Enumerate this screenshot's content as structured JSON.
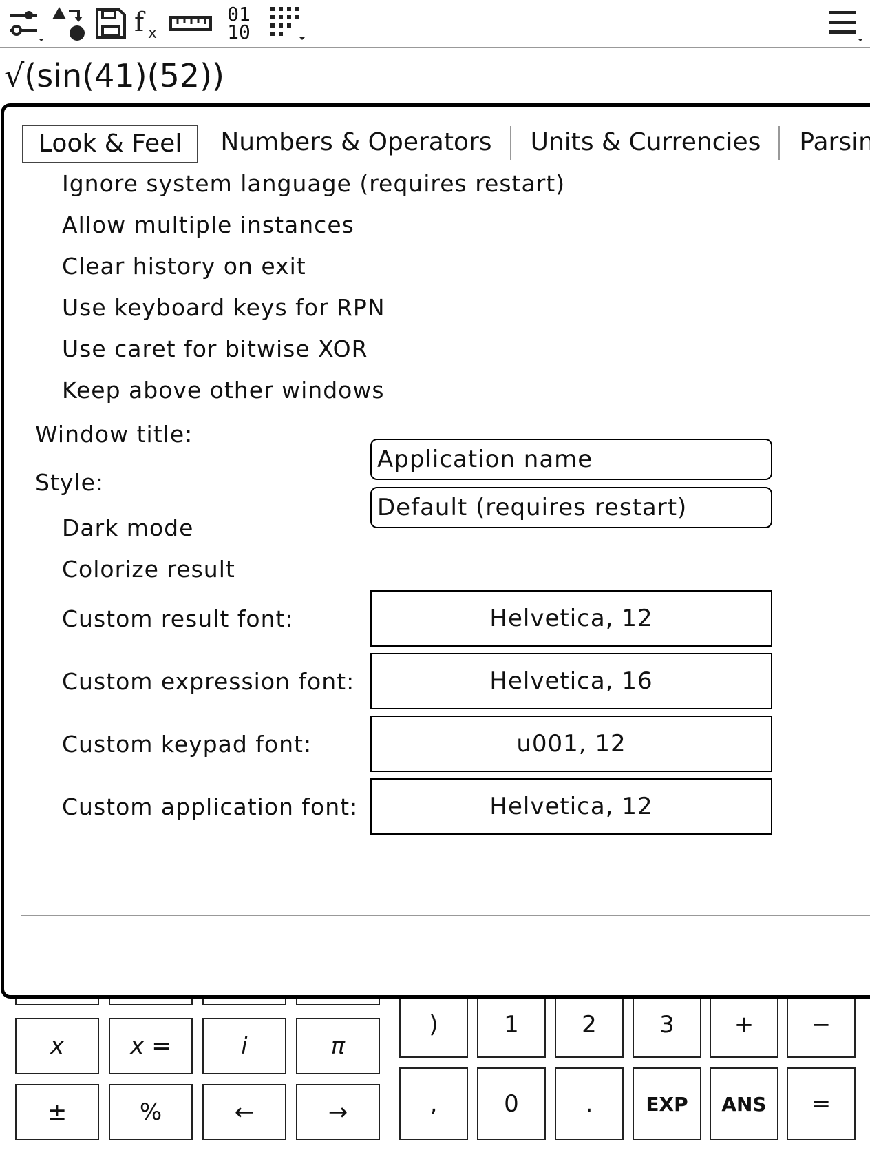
{
  "toolbar": {
    "icons": [
      "settings-sliders-icon",
      "shapes-icon",
      "save-icon",
      "function-icon",
      "ruler-icon",
      "binary-icon",
      "keypad-grid-icon",
      "hamburger-menu-icon"
    ],
    "binary_top": "01",
    "binary_bottom": "10"
  },
  "expression": "√(sin(41)(52))",
  "preferences": {
    "tabs": [
      "Look & Feel",
      "Numbers & Operators",
      "Units & Currencies",
      "Parsing"
    ],
    "options": [
      "Ignore system language (requires restart)",
      "Allow multiple instances",
      "Clear history on exit",
      "Use keyboard keys for RPN",
      "Use caret for bitwise XOR",
      "Keep above other windows"
    ],
    "window_title_label": "Window title:",
    "window_title_value": "Application name",
    "style_label": "Style:",
    "style_value": "Default (requires restart)",
    "dark_mode": "Dark mode",
    "colorize_result": "Colorize result",
    "fonts": [
      {
        "label": "Custom result font:",
        "value": "Helvetica, 12"
      },
      {
        "label": "Custom expression font:",
        "value": "Helvetica, 16"
      },
      {
        "label": "Custom keypad font:",
        "value": "u001, 12"
      },
      {
        "label": "Custom application font:",
        "value": "Helvetica, 12"
      }
    ]
  },
  "keypad": {
    "left_row1": [
      "x",
      "x =",
      "i",
      "π"
    ],
    "left_row2": [
      "±",
      "%",
      "←",
      "→"
    ],
    "right_row1": [
      ")",
      "1",
      "2",
      "3",
      "+",
      "−"
    ],
    "right_row2": [
      ",",
      "0",
      ".",
      "EXP",
      "ANS",
      "="
    ]
  }
}
